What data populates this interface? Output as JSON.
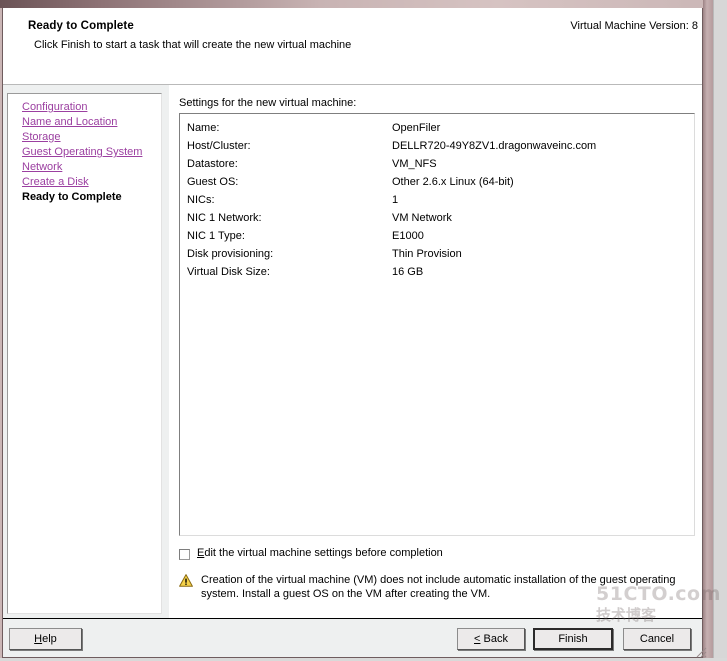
{
  "header": {
    "title": "Ready to Complete",
    "subtitle": "Click Finish to start a task that will create the new virtual machine",
    "version_label": "Virtual Machine Version: 8"
  },
  "sidebar": {
    "items": [
      {
        "label": "Configuration",
        "current": false
      },
      {
        "label": "Name and Location",
        "current": false
      },
      {
        "label": "Storage",
        "current": false
      },
      {
        "label": "Guest Operating System",
        "current": false
      },
      {
        "label": "Network",
        "current": false
      },
      {
        "label": "Create a Disk",
        "current": false
      },
      {
        "label": "Ready to Complete",
        "current": true
      }
    ]
  },
  "main": {
    "section_label": "Settings for the new virtual machine:",
    "settings": [
      {
        "label": "Name:",
        "value": "OpenFiler"
      },
      {
        "label": "Host/Cluster:",
        "value": "DELLR720-49Y8ZV1.dragonwaveinc.com"
      },
      {
        "label": "Datastore:",
        "value": "VM_NFS"
      },
      {
        "label": "Guest OS:",
        "value": "Other 2.6.x Linux (64-bit)"
      },
      {
        "label": "NICs:",
        "value": "1"
      },
      {
        "label": "NIC 1 Network:",
        "value": "VM Network"
      },
      {
        "label": "NIC 1 Type:",
        "value": "E1000"
      },
      {
        "label": "Disk provisioning:",
        "value": "Thin Provision"
      },
      {
        "label": "Virtual Disk Size:",
        "value": "16 GB"
      }
    ],
    "edit_checkbox": {
      "label_prefix": "",
      "label_accel": "E",
      "label_rest": "dit the virtual machine settings before completion",
      "checked": false
    },
    "warning": {
      "icon": "warning-triangle-icon",
      "text": "Creation of the virtual machine (VM) does not include automatic installation of the guest operating system. Install a guest OS on the VM after creating the VM."
    }
  },
  "footer": {
    "help": {
      "accel": "H",
      "rest": "elp"
    },
    "back": "< Back",
    "finish": "Finish",
    "cancel": "Cancel"
  },
  "watermark": {
    "line1": "51CTO.com",
    "line2": "技术博客"
  },
  "colors": {
    "link": "#9b3fa0",
    "warning": "#f2c14b",
    "panel": "#eef0f0",
    "titlebar": "#c8b3b3"
  }
}
